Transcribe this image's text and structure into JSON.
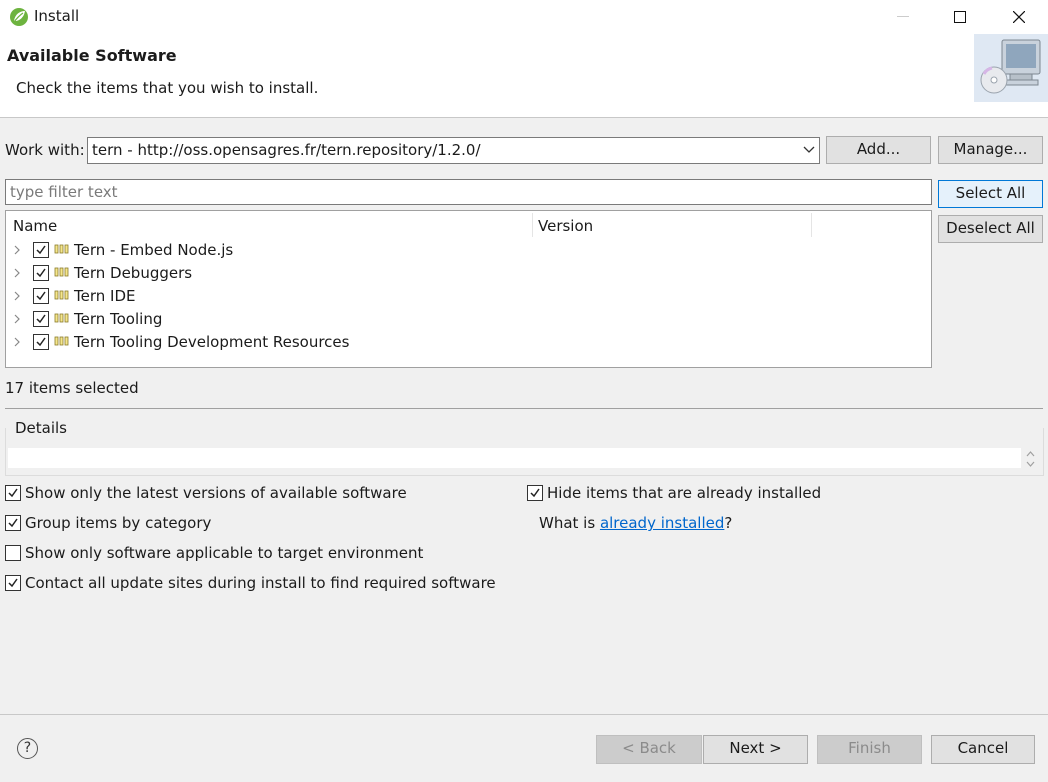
{
  "window": {
    "title": "Install",
    "icon": "spring-leaf-icon"
  },
  "header": {
    "title": "Available Software",
    "subtitle": "Check the items that you wish to install.",
    "image": "monitor-cd-icon"
  },
  "work_with": {
    "label": "Work with:",
    "value": "tern - http://oss.opensagres.fr/tern.repository/1.2.0/",
    "add_label": "Add...",
    "manage_label": "Manage..."
  },
  "filter": {
    "placeholder": "type filter text"
  },
  "side_buttons": {
    "select_all": "Select All",
    "deselect_all": "Deselect All"
  },
  "tree": {
    "columns": [
      "Name",
      "Version"
    ],
    "items": [
      {
        "label": "Tern - Embed Node.js",
        "checked": true
      },
      {
        "label": "Tern Debuggers",
        "checked": true
      },
      {
        "label": "Tern IDE",
        "checked": true
      },
      {
        "label": "Tern Tooling",
        "checked": true
      },
      {
        "label": "Tern Tooling Development Resources",
        "checked": true
      }
    ]
  },
  "status": {
    "selected": "17 items selected"
  },
  "details": {
    "label": "Details"
  },
  "options": {
    "latest_versions": {
      "label": "Show only the latest versions of available software",
      "checked": true
    },
    "group_by_category": {
      "label": "Group items by category",
      "checked": true
    },
    "target_env": {
      "label": "Show only software applicable to target environment",
      "checked": false
    },
    "contact_sites": {
      "label": "Contact all update sites during install to find required software",
      "checked": true
    },
    "hide_installed": {
      "label": "Hide items that are already installed",
      "checked": true
    },
    "what_is": {
      "prefix": "What is ",
      "link": "already installed",
      "suffix": "?"
    }
  },
  "footer": {
    "help_icon": "help-icon",
    "help_glyph": "?",
    "back": "< Back",
    "next": "Next >",
    "finish": "Finish",
    "cancel": "Cancel"
  },
  "colors": {
    "accent": "#0078d7",
    "link": "#0066cc",
    "background": "#f0f0f0"
  }
}
